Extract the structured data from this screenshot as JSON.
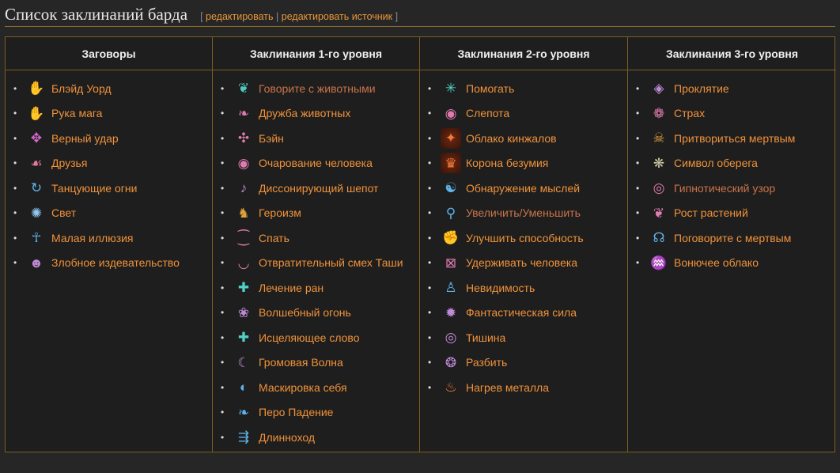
{
  "heading": {
    "title": "Список заклинаний барда",
    "edit_open": "[",
    "edit_label": "редактировать",
    "edit_sep": "|",
    "edit_source_label": "редактировать источник",
    "edit_close": "]"
  },
  "columns": [
    {
      "header": "Заговоры",
      "items": [
        {
          "label": "Блэйд Уорд",
          "icon": "blade-ward-icon",
          "glyph": "✋",
          "color": "#e0a33a"
        },
        {
          "label": "Рука мага",
          "icon": "mage-hand-icon",
          "glyph": "✋",
          "color": "#5fb3e8"
        },
        {
          "label": "Верный удар",
          "icon": "true-strike-icon",
          "glyph": "✥",
          "color": "#d86ad0"
        },
        {
          "label": "Друзья",
          "icon": "friends-icon",
          "glyph": "☙",
          "color": "#e07a9a"
        },
        {
          "label": "Танцующие огни",
          "icon": "dancing-lights-icon",
          "glyph": "↻",
          "color": "#5fb3e8"
        },
        {
          "label": "Свет",
          "icon": "light-icon",
          "glyph": "✺",
          "color": "#8fc8f0"
        },
        {
          "label": "Малая иллюзия",
          "icon": "minor-illusion-icon",
          "glyph": "☥",
          "color": "#5fb3e8"
        },
        {
          "label": "Злобное издевательство",
          "icon": "vicious-mockery-icon",
          "glyph": "☻",
          "color": "#c08ad8"
        }
      ]
    },
    {
      "header": "Заклинания 1-го уровня",
      "items": [
        {
          "label": "Говорите с животными",
          "icon": "speak-with-animals-icon",
          "glyph": "❦",
          "color": "#4fc8c0",
          "visited": true
        },
        {
          "label": "Дружба животных",
          "icon": "animal-friendship-icon",
          "glyph": "❧",
          "color": "#e07ab0"
        },
        {
          "label": "Бэйн",
          "icon": "bane-icon",
          "glyph": "✣",
          "color": "#e07ab0"
        },
        {
          "label": "Очарование человека",
          "icon": "charm-person-icon",
          "glyph": "◉",
          "color": "#e07ab0"
        },
        {
          "label": "Диссонирующий шепот",
          "icon": "dissonant-whispers-icon",
          "glyph": "♪",
          "color": "#c08ad8"
        },
        {
          "label": "Героизм",
          "icon": "heroism-icon",
          "glyph": "♞",
          "color": "#e0a33a"
        },
        {
          "label": "Спать",
          "icon": "sleep-icon",
          "glyph": "⁐",
          "color": "#e07ab0"
        },
        {
          "label": "Отвратительный смех Таши",
          "icon": "tashas-laughter-icon",
          "glyph": "◡",
          "color": "#e07ab0"
        },
        {
          "label": "Лечение ран",
          "icon": "cure-wounds-icon",
          "glyph": "✚",
          "color": "#4fd0c8"
        },
        {
          "label": "Волшебный огонь",
          "icon": "faerie-fire-icon",
          "glyph": "❀",
          "color": "#c08ad8"
        },
        {
          "label": "Исцеляющее слово",
          "icon": "healing-word-icon",
          "glyph": "✚",
          "color": "#4fd0c8"
        },
        {
          "label": "Громовая Волна",
          "icon": "thunderwave-icon",
          "glyph": "☾",
          "color": "#c08ad8"
        },
        {
          "label": "Маскировка себя",
          "icon": "disguise-self-icon",
          "glyph": "◐",
          "color": "#5fb3e8"
        },
        {
          "label": "Перо Падение",
          "icon": "feather-fall-icon",
          "glyph": "❧",
          "color": "#5fb3e8"
        },
        {
          "label": "Длинноход",
          "icon": "longstrider-icon",
          "glyph": "⇶",
          "color": "#5fb3e8"
        }
      ]
    },
    {
      "header": "Заклинания 2-го уровня",
      "items": [
        {
          "label": "Помогать",
          "icon": "aid-icon",
          "glyph": "✳",
          "color": "#4fd0c8"
        },
        {
          "label": "Слепота",
          "icon": "blindness-icon",
          "glyph": "◉",
          "color": "#e07ab0"
        },
        {
          "label": "Облако кинжалов",
          "icon": "cloud-of-daggers-icon",
          "glyph": "✦",
          "color": "#f07a3a",
          "dark": true
        },
        {
          "label": "Корона безумия",
          "icon": "crown-of-madness-icon",
          "glyph": "♛",
          "color": "#f07a3a",
          "dark": true
        },
        {
          "label": "Обнаружение мыслей",
          "icon": "detect-thoughts-icon",
          "glyph": "☯",
          "color": "#5fb3e8"
        },
        {
          "label": "Увеличить/Уменьшить",
          "icon": "enlarge-reduce-icon",
          "glyph": "⚲",
          "color": "#5fb3e8",
          "visited": true
        },
        {
          "label": "Улучшить способность",
          "icon": "enhance-ability-icon",
          "glyph": "✊",
          "color": "#e0a33a"
        },
        {
          "label": "Удерживать человека",
          "icon": "hold-person-icon",
          "glyph": "⊠",
          "color": "#e07ab0"
        },
        {
          "label": "Невидимость",
          "icon": "invisibility-icon",
          "glyph": "♙",
          "color": "#5fb3e8"
        },
        {
          "label": "Фантастическая сила",
          "icon": "phantasmal-force-icon",
          "glyph": "✹",
          "color": "#c08ad8"
        },
        {
          "label": "Тишина",
          "icon": "silence-icon",
          "glyph": "◎",
          "color": "#c08ad8"
        },
        {
          "label": "Разбить",
          "icon": "shatter-icon",
          "glyph": "❂",
          "color": "#c08ad8"
        },
        {
          "label": "Нагрев металла",
          "icon": "heat-metal-icon",
          "glyph": "♨",
          "color": "#f07a3a"
        }
      ]
    },
    {
      "header": "Заклинания 3-го уровня",
      "items": [
        {
          "label": "Проклятие",
          "icon": "bestow-curse-icon",
          "glyph": "◈",
          "color": "#c08ad8"
        },
        {
          "label": "Страх",
          "icon": "fear-icon",
          "glyph": "❁",
          "color": "#e07ab0"
        },
        {
          "label": "Притвориться мертвым",
          "icon": "feign-death-icon",
          "glyph": "☠",
          "color": "#e0a33a"
        },
        {
          "label": "Символ оберега",
          "icon": "glyph-of-warding-icon",
          "glyph": "❋",
          "color": "#c8c8a0"
        },
        {
          "label": "Гипнотический узор",
          "icon": "hypnotic-pattern-icon",
          "glyph": "◎",
          "color": "#e07ab0",
          "visited": true
        },
        {
          "label": "Рост растений",
          "icon": "plant-growth-icon",
          "glyph": "❦",
          "color": "#e07ab0"
        },
        {
          "label": "Поговорите с мертвым",
          "icon": "speak-with-dead-icon",
          "glyph": "☊",
          "color": "#5fb3e8"
        },
        {
          "label": "Вонючее облако",
          "icon": "stinking-cloud-icon",
          "glyph": "♒",
          "color": "#c8c83a"
        }
      ]
    }
  ]
}
